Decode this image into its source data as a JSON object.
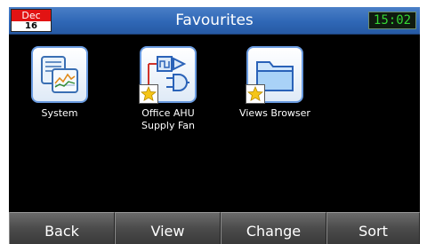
{
  "header": {
    "date_month": "Dec",
    "date_day": "16",
    "title": "Favourites",
    "clock": "15:02"
  },
  "favourites": [
    {
      "label": "System",
      "icon": "system-dashboard-icon",
      "starred": false
    },
    {
      "label": "Office AHU Supply Fan",
      "label_line1": "Office AHU",
      "label_line2": "Supply Fan",
      "icon": "logic-diagram-icon",
      "starred": true
    },
    {
      "label": "Views Browser",
      "icon": "folder-icon",
      "starred": true
    }
  ],
  "softkeys": [
    "Back",
    "View",
    "Change",
    "Sort"
  ],
  "colors": {
    "title_bar": "#2f67b6",
    "date_month_bg": "#e21313",
    "clock_text": "#34d634",
    "background": "#000000",
    "star": "#f5c518"
  }
}
